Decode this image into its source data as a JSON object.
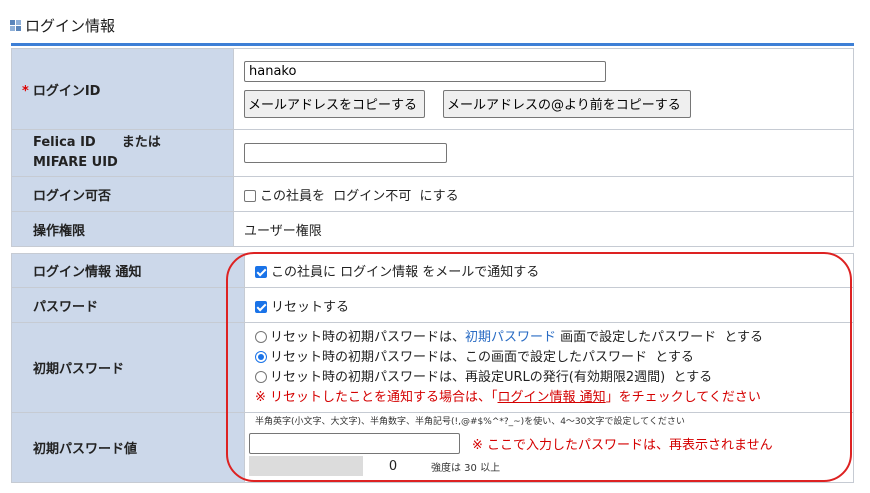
{
  "section": {
    "title": "ログイン情報",
    "icon": "grid-icon"
  },
  "login_id": {
    "required_mark": "*",
    "label": "ログインID",
    "value": "hanako",
    "copy_email_button": "メールアドレスをコピーする",
    "copy_email_local_button": "メールアドレスの@より前をコピーする"
  },
  "felica": {
    "label_line1": "Felica ID　　または",
    "label_line2": "MIFARE UID",
    "value": ""
  },
  "login_allowed": {
    "label": "ログイン可否",
    "checkbox_text": "この社員を  ログイン不可  にする",
    "checked": false
  },
  "permission": {
    "label": "操作権限",
    "value": "ユーザー権限"
  },
  "notify": {
    "label": "ログイン情報 通知",
    "checkbox_text": "この社員に ログイン情報 をメールで通知する",
    "checked": true
  },
  "password": {
    "label": "パスワード",
    "checkbox_text": "リセットする",
    "checked": true
  },
  "initial_password": {
    "label": "初期パスワード",
    "option1_prefix": "リセット時の初期パスワードは、",
    "option1_link": "初期パスワード",
    "option1_suffix": " 画面で設定したパスワード  とする",
    "option2": "リセット時の初期パスワードは、この画面で設定したパスワード  とする",
    "option3": "リセット時の初期パスワードは、再設定URLの発行(有効期限2週間)  とする",
    "selected_option": 2,
    "warning_prefix": "※ リセットしたことを通知する場合は、「",
    "warning_link": "ログイン情報 通知",
    "warning_suffix": "」をチェックしてください"
  },
  "initial_password_value": {
    "label": "初期パスワード値",
    "hint": "半角英字(小文字、大文字)、半角数字、半角記号(!,@#$%^*?_~)を使い、4〜30文字で設定してください",
    "value": "",
    "warning": "※ ここで入力したパスワードは、再表示されません",
    "strength_value": "0",
    "strength_fill": 0,
    "strength_note": "強度は 30 以上"
  },
  "colors": {
    "label_bg": "#ccd8ea",
    "accent_rule": "#3d7fd6",
    "highlight_oval": "#d22222",
    "link": "#2a6cc4",
    "warning": "#d40000"
  }
}
